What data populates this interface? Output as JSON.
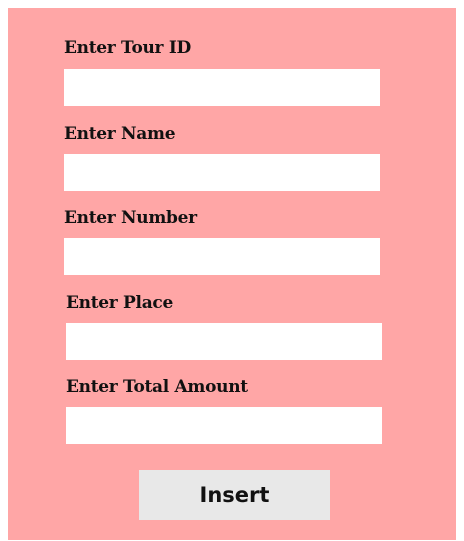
{
  "form": {
    "fields": [
      {
        "label": "Enter Tour ID",
        "value": "",
        "placeholder": ""
      },
      {
        "label": "Enter Name",
        "value": "",
        "placeholder": ""
      },
      {
        "label": "Enter Number",
        "value": "",
        "placeholder": ""
      },
      {
        "label": "Enter Place",
        "value": "",
        "placeholder": ""
      },
      {
        "label": "Enter Total Amount",
        "value": "",
        "placeholder": ""
      }
    ],
    "insert_label": "Insert"
  },
  "colors": {
    "panel_background": "#ffa6a6",
    "input_background": "#ffffff",
    "button_background": "#e8e8e8"
  }
}
